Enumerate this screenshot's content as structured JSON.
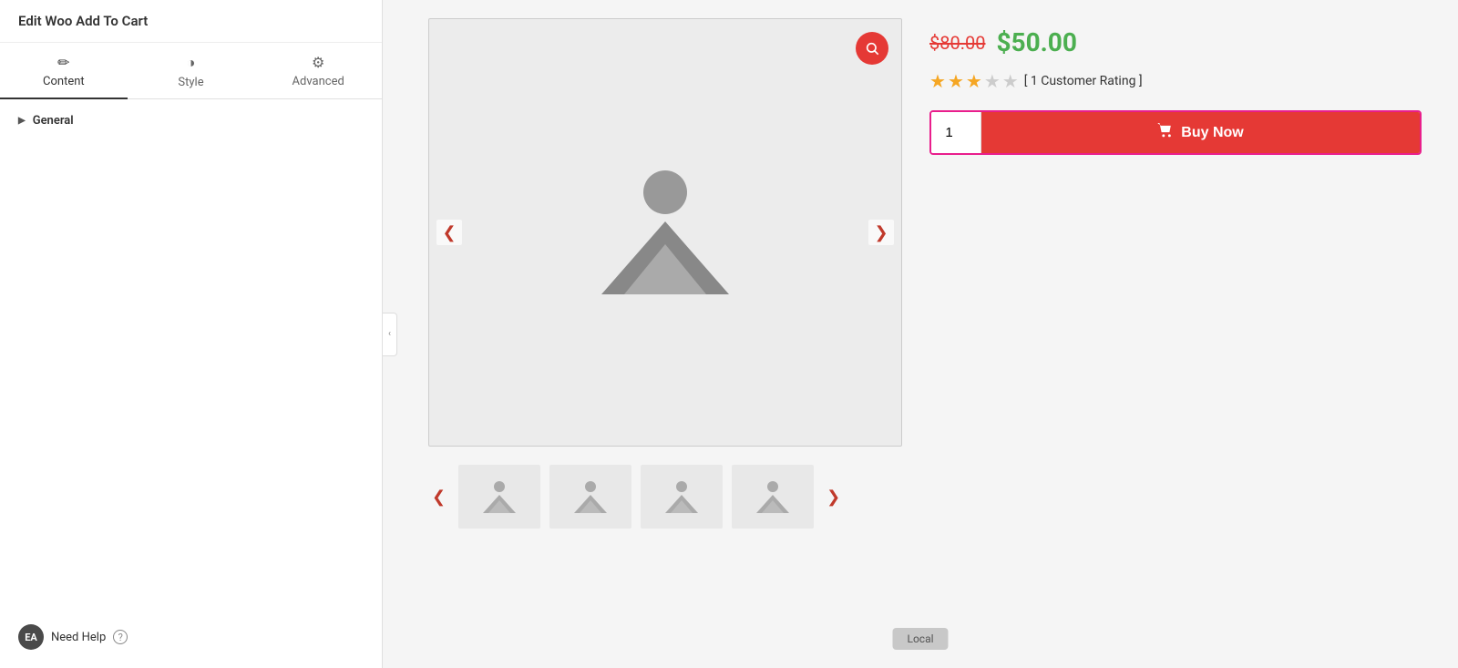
{
  "panel": {
    "title": "Edit Woo Add To Cart",
    "tabs": [
      {
        "id": "content",
        "label": "Content",
        "icon": "✏️",
        "active": true
      },
      {
        "id": "style",
        "label": "Style",
        "icon": "◑",
        "active": false
      },
      {
        "id": "advanced",
        "label": "Advanced",
        "icon": "⚙",
        "active": false
      }
    ],
    "general_label": "General",
    "need_help_label": "Need Help",
    "help_icon_label": "?"
  },
  "product": {
    "old_price": "$80.00",
    "new_price": "$50.00",
    "rating_text": "[ 1 Customer Rating ]",
    "stars": [
      true,
      true,
      true,
      false,
      false
    ],
    "quantity": "1",
    "buy_now_label": "Buy Now"
  },
  "thumbnails": [
    {
      "id": "thumb-1"
    },
    {
      "id": "thumb-2"
    },
    {
      "id": "thumb-3"
    },
    {
      "id": "thumb-4"
    }
  ],
  "local_badge": "Local",
  "colors": {
    "accent_red": "#e53935",
    "accent_green": "#4caf50",
    "accent_pink": "#e91e8c",
    "star_filled": "#f5a623",
    "star_empty": "#cccccc",
    "old_price": "#e53935"
  }
}
